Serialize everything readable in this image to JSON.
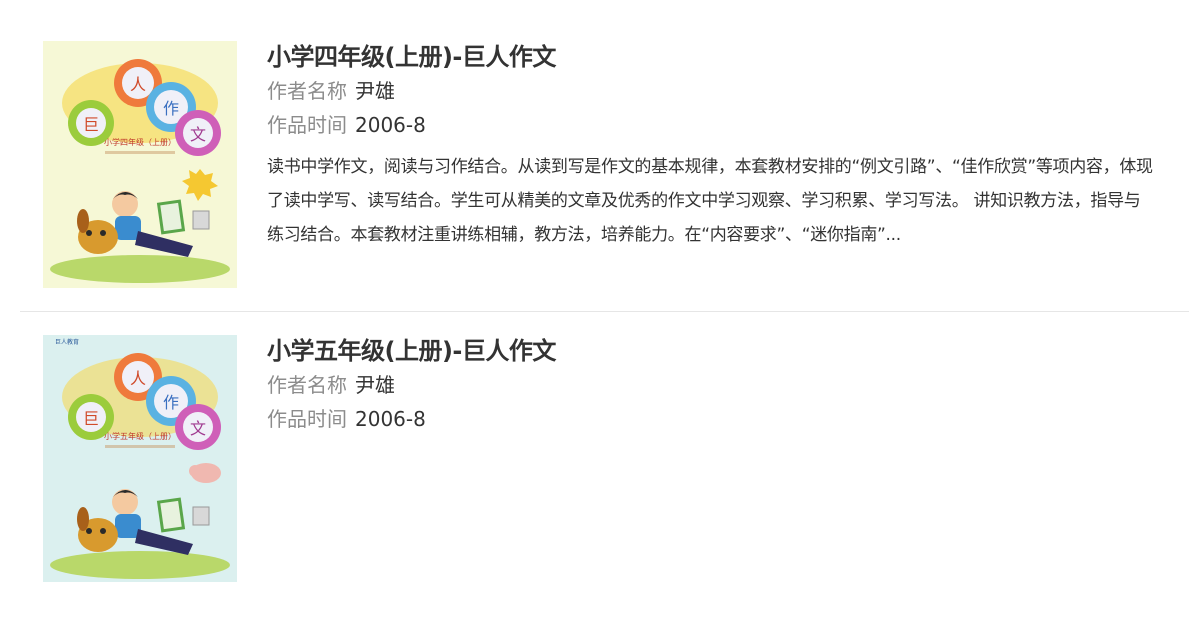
{
  "books": [
    {
      "title": "小学四年级(上册)-巨人作文",
      "author_label": "作者名称",
      "author": "尹雄",
      "time_label": "作品时间",
      "time": "2006-8",
      "description": "读书中学作文，阅读与习作结合。从读到写是作文的基本规律，本套教材安排的“例文引路”、“佳作欣赏”等项内容，体现了读中学写、读写结合。学生可从精美的文章及优秀的作文中学习观察、学习积累、学习写法。 讲知识教方法，指导与练习结合。本套教材注重讲练相辅，教方法，培养能力。在“内容要求”、“迷你指南”...",
      "cover": {
        "bg_color": "#f6f8d6",
        "chars": [
          "巨",
          "人",
          "作",
          "文"
        ],
        "grade": "小学四年级（上册）"
      }
    },
    {
      "title": "小学五年级(上册)-巨人作文",
      "author_label": "作者名称",
      "author": "尹雄",
      "time_label": "作品时间",
      "time": "2006-8",
      "cover": {
        "bg_color": "#dbf0ef",
        "chars": [
          "巨",
          "人",
          "作",
          "文"
        ],
        "grade": "小学五年级（上册）",
        "publisher_top": "巨人教育"
      }
    }
  ]
}
